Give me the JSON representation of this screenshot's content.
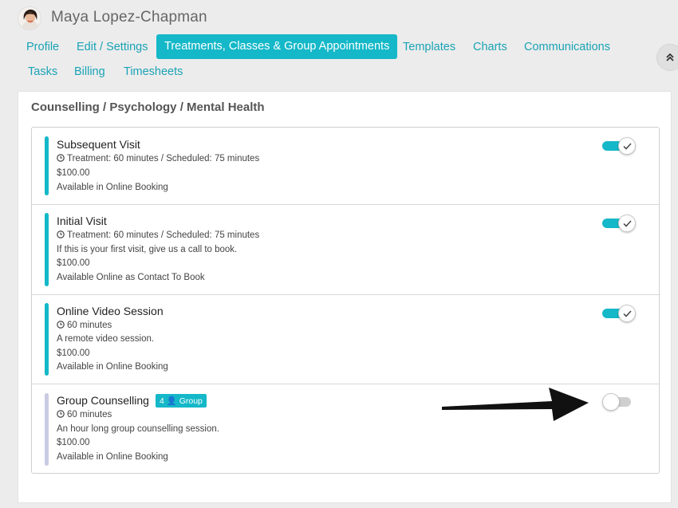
{
  "header": {
    "user_name": "Maya Lopez-Chapman",
    "nav": [
      {
        "label": "Profile"
      },
      {
        "label": "Edit / Settings"
      },
      {
        "label": "Treatments, Classes & Group Appointments"
      },
      {
        "label": "Templates"
      },
      {
        "label": "Charts"
      },
      {
        "label": "Communications"
      },
      {
        "label": "Tasks"
      },
      {
        "label": "Billing"
      },
      {
        "label": "Timesheets"
      }
    ],
    "active_tab": "Treatments, Classes & Group Appointments"
  },
  "section": {
    "title": "Counselling / Psychology / Mental Health",
    "items": [
      {
        "name": "Subsequent Visit",
        "duration": "Treatment: 60 minutes / Scheduled: 75 minutes",
        "price": "$100.00",
        "availability": "Available in Online Booking",
        "enabled": true
      },
      {
        "name": "Initial Visit",
        "duration": "Treatment: 60 minutes / Scheduled: 75 minutes",
        "description": "If this is your first visit, give us a call to book.",
        "price": "$100.00",
        "availability": "Available Online as Contact To Book",
        "enabled": true
      },
      {
        "name": "Online Video Session",
        "duration": "60 minutes",
        "description": "A remote video session.",
        "price": "$100.00",
        "availability": "Available in Online Booking",
        "enabled": true
      },
      {
        "name": "Group Counselling",
        "badge": "4 👤 Group",
        "duration": "60 minutes",
        "description": "An hour long group counselling session.",
        "price": "$100.00",
        "availability": "Available in Online Booking",
        "enabled": false
      }
    ]
  },
  "colors": {
    "accent": "#14b8c8",
    "link": "#1aa3b5",
    "disabled_bar": "#c9cbe2",
    "toggle_off": "#cfcfcf"
  }
}
